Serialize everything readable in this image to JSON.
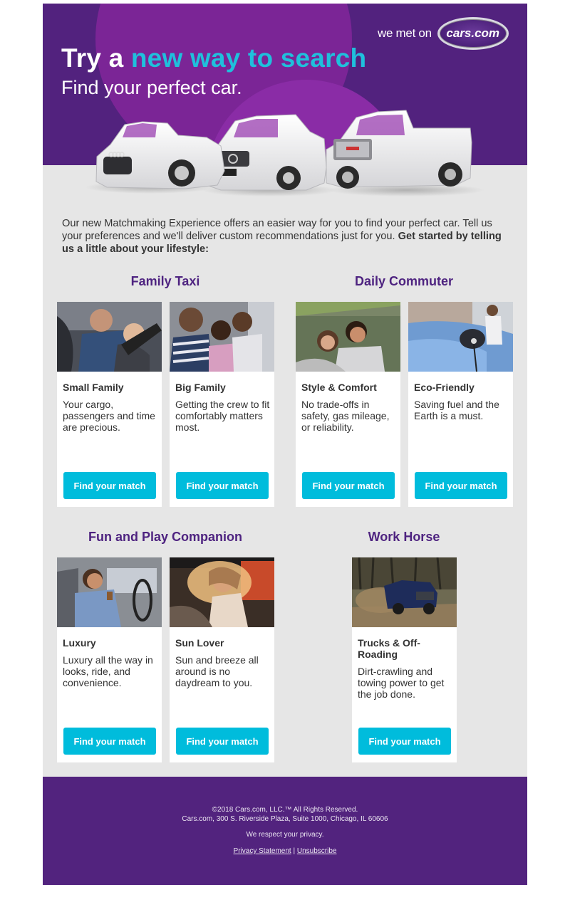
{
  "hero": {
    "title_plain": "Try a ",
    "title_accent": "new way to search",
    "subtitle": "Find your perfect car.",
    "logo_prefix": "we met on",
    "logo_brand": "cars.com",
    "cars": [
      "Audi convertible",
      "Volvo SUV",
      "GMC pickup truck"
    ]
  },
  "intro": {
    "text": "Our new Matchmaking Experience offers an easier way for you to find your perfect car. Tell us your preferences and we'll deliver custom recommendations just for you. ",
    "bold": "Get started by telling us a little about your lifestyle:"
  },
  "sections": [
    {
      "title": "Family Taxi",
      "cards": [
        {
          "image": "parent buckling baby into car seat",
          "title": "Small Family",
          "desc": "Your cargo, passengers and time are precious.",
          "button": "Find your match"
        },
        {
          "image": "three girls in back seat",
          "title": "Big Family",
          "desc": "Getting the crew to fit comfortably matters most.",
          "button": "Find your match"
        }
      ]
    },
    {
      "title": "Daily Commuter",
      "cards": [
        {
          "image": "couple smiling in car",
          "title": "Style & Comfort",
          "desc": "No trade-offs in safety, gas mileage, or reliability.",
          "button": "Find your match"
        },
        {
          "image": "electric car charging",
          "title": "Eco-Friendly",
          "desc": "Saving fuel and the Earth is a must.",
          "button": "Find your match"
        }
      ]
    },
    {
      "title": "Fun and Play Companion",
      "cards": [
        {
          "image": "man in suit driving with coffee",
          "title": "Luxury",
          "desc": "Luxury all the way in looks, ride, and convenience.",
          "button": "Find your match"
        },
        {
          "image": "woman in sunglasses in convertible",
          "title": "Sun Lover",
          "desc": "Sun and breeze all around is no daydream to you.",
          "button": "Find your match"
        }
      ]
    },
    {
      "title": "Work Horse",
      "cards": [
        {
          "image": "pickup truck off-roading in mud",
          "title": "Trucks & Off-Roading",
          "desc": "Dirt-crawling and towing power to get the job done.",
          "button": "Find your match"
        }
      ]
    }
  ],
  "footer": {
    "copyright": "©2018 Cars.com, LLC.™ All Rights Reserved.",
    "address": "Cars.com, 300 S. Riverside Plaza, Suite 1000, Chicago, IL 60606",
    "privacy_note": "We respect your privacy.",
    "privacy_link": "Privacy Statement",
    "separator": "|",
    "unsubscribe_link": "Unsubscribe"
  },
  "colors": {
    "brand_purple": "#52227e",
    "heading_purple": "#4e2380",
    "accent_cyan": "#1fc0dc",
    "button_cyan": "#00bcdc",
    "background_gray": "#e6e6e6"
  }
}
